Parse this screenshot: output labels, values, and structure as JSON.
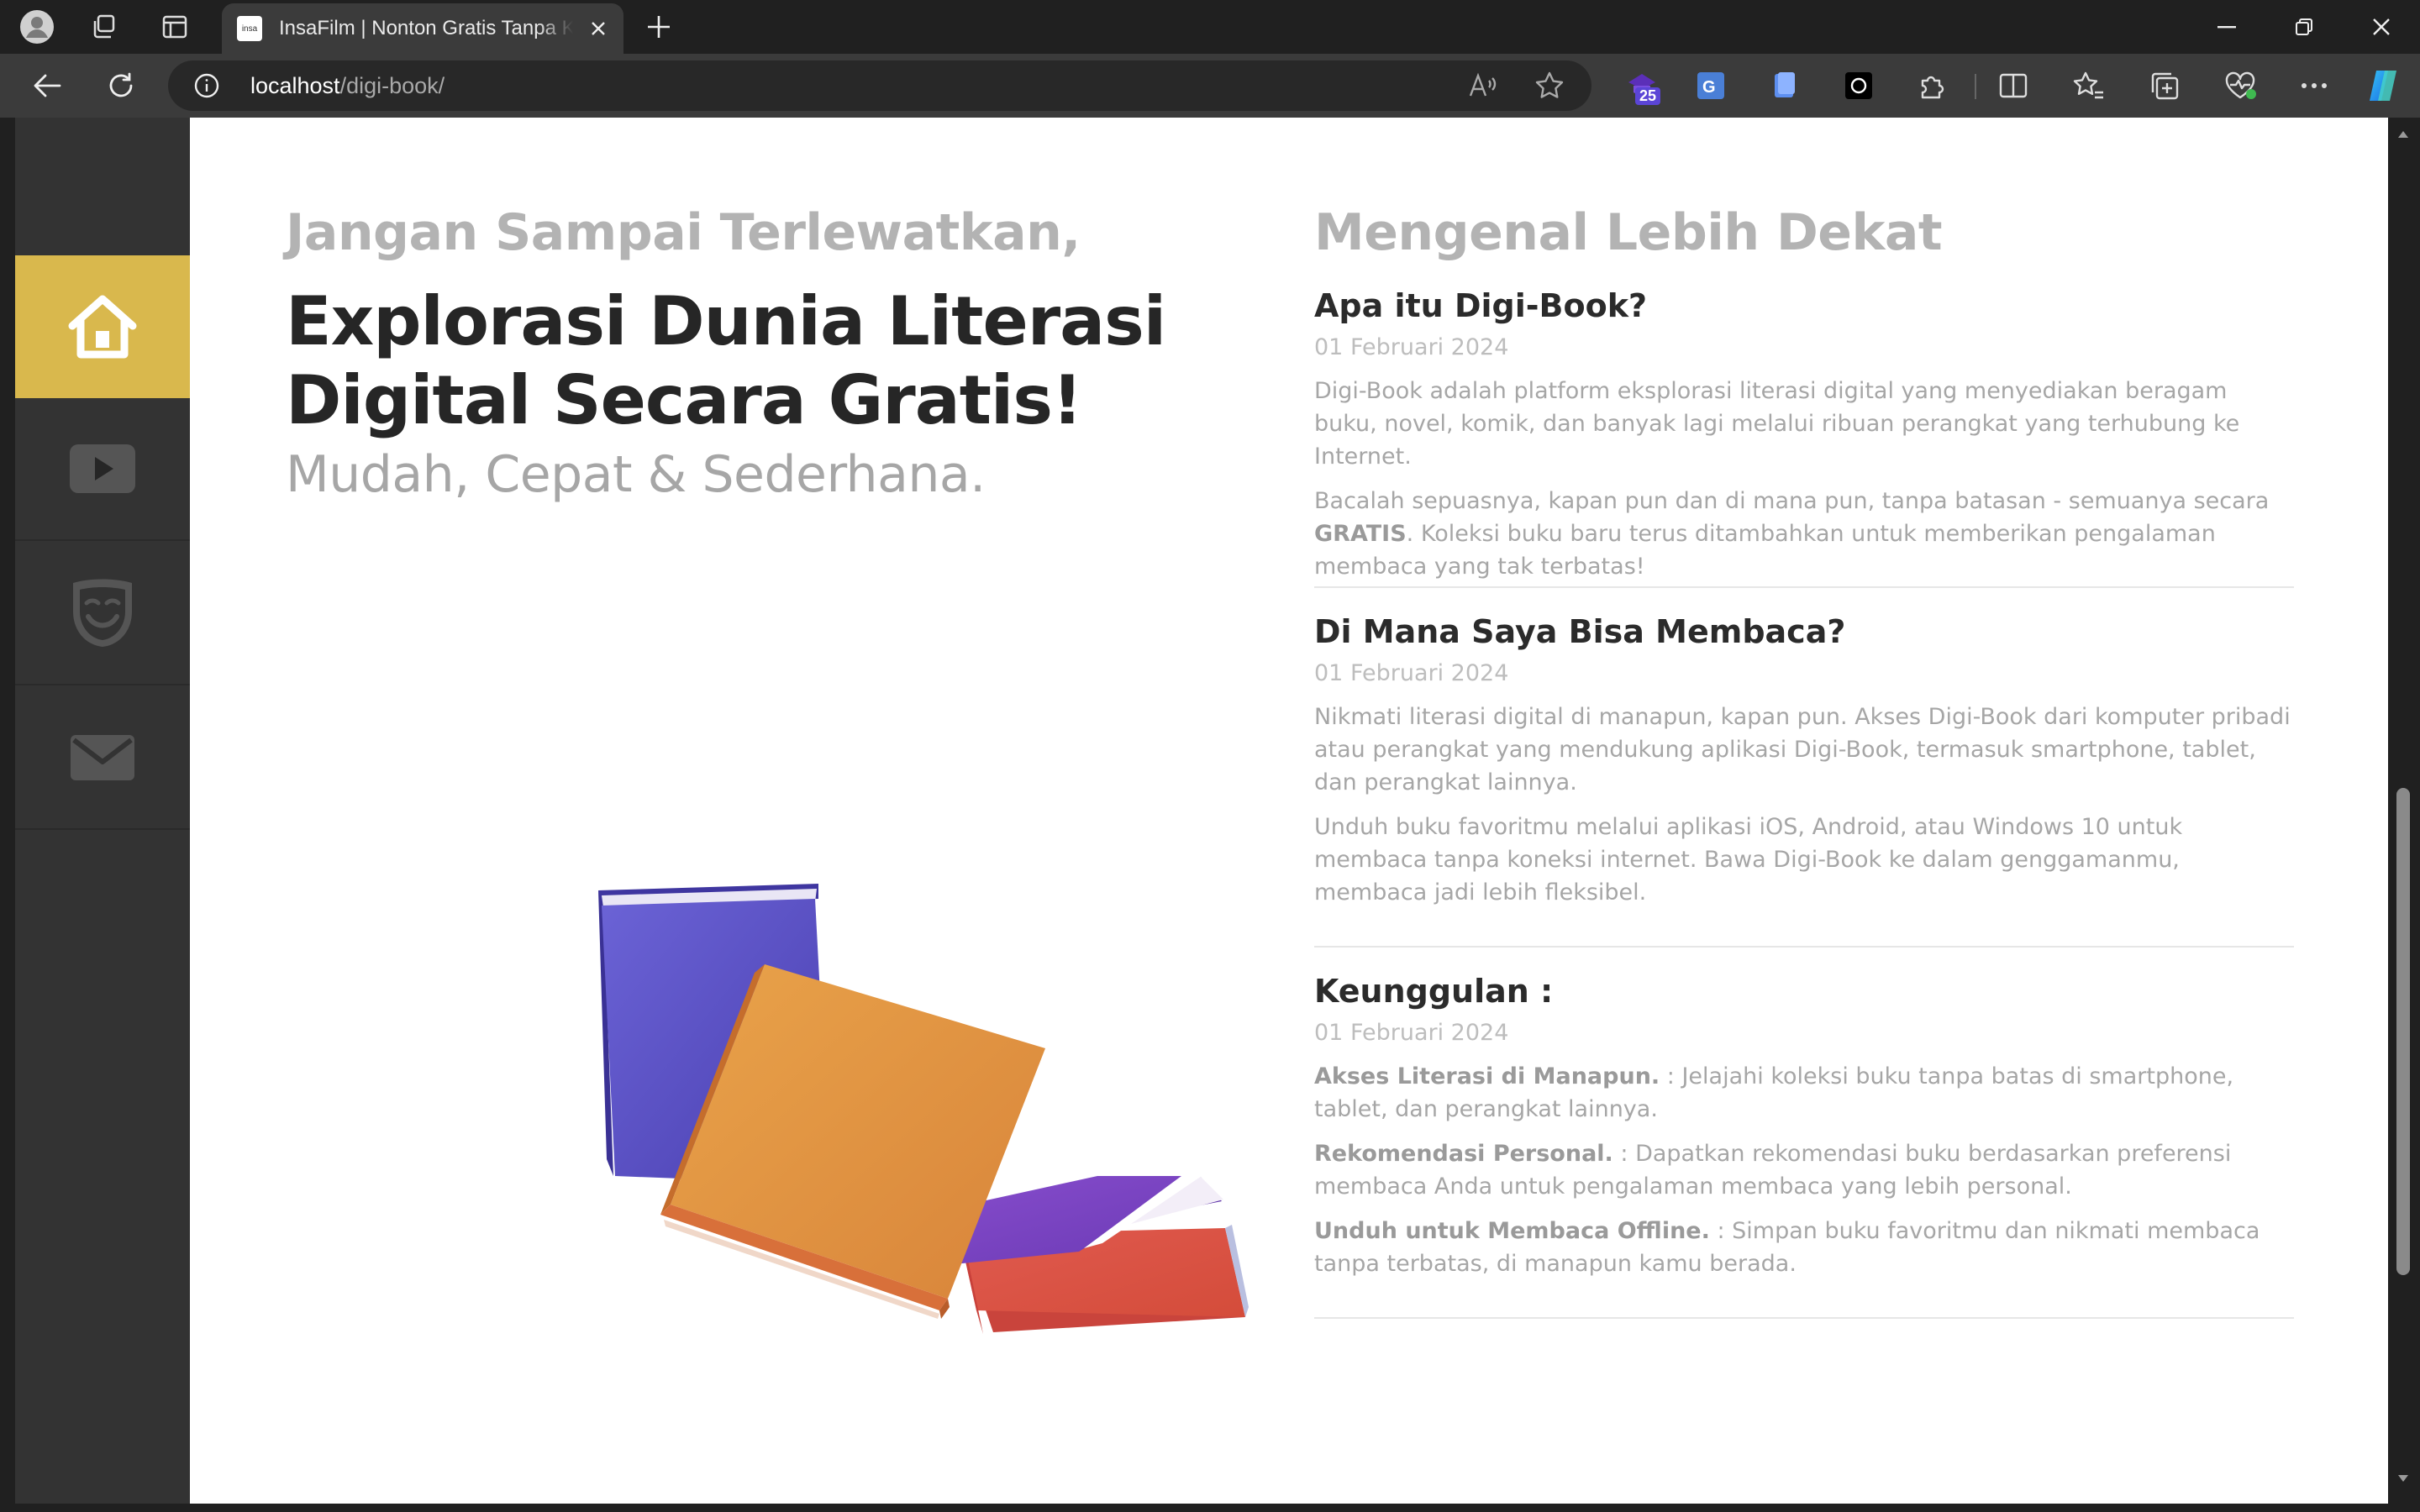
{
  "browser": {
    "tab_title": "InsaFilm | Nonton Gratis Tanpa K",
    "favicon_text": "insa",
    "url_host": "localhost",
    "url_path": "/digi-book/",
    "ext_badge": "25"
  },
  "sidebar": {
    "items": [
      {
        "name": "home",
        "icon": "home-icon",
        "active": true
      },
      {
        "name": "video",
        "icon": "play-icon",
        "active": false
      },
      {
        "name": "masks",
        "icon": "mask-icon",
        "active": false
      },
      {
        "name": "mail",
        "icon": "mail-icon",
        "active": false
      }
    ],
    "active_color": "#d9b84d"
  },
  "hero": {
    "kicker": "Jangan Sampai Terlewatkan,",
    "headline_line1": "Explorasi Dunia Literasi",
    "headline_line2": "Digital Secara Gratis!",
    "subhead": "Mudah, Cepat & Sederhana."
  },
  "about": {
    "title": "Mengenal Lebih Dekat",
    "articles": [
      {
        "title": "Apa itu Digi-Book?",
        "date": "01 Februari 2024",
        "p1": "Digi-Book adalah platform eksplorasi literasi digital yang menyediakan beragam buku, novel, komik, dan banyak lagi melalui ribuan perangkat yang terhubung ke Internet.",
        "p2_before": "Bacalah sepuasnya, kapan pun dan di mana pun, tanpa batasan - semuanya secara ",
        "p2_bold": "GRATIS",
        "p2_after": ". Koleksi buku baru terus ditambahkan untuk memberikan pengalaman membaca yang tak terbatas!"
      },
      {
        "title": "Di Mana Saya Bisa Membaca?",
        "date": "01 Februari 2024",
        "p1": "Nikmati literasi digital di manapun, kapan pun. Akses Digi-Book dari komputer pribadi atau perangkat yang mendukung aplikasi Digi-Book, termasuk smartphone, tablet, dan perangkat lainnya.",
        "p2": "Unduh buku favoritmu melalui aplikasi iOS, Android, atau Windows 10 untuk membaca tanpa koneksi internet. Bawa Digi-Book ke dalam genggamanmu, membaca jadi lebih fleksibel."
      },
      {
        "title": "Keunggulan :",
        "date": "01 Februari 2024",
        "f1_bold": "Akses Literasi di Manapun.",
        "f1_text": " : Jelajahi koleksi buku tanpa batas di smartphone, tablet, dan perangkat lainnya.",
        "f2_bold": "Rekomendasi Personal.",
        "f2_text": " : Dapatkan rekomendasi buku berdasarkan preferensi membaca Anda untuk pengalaman membaca yang lebih personal.",
        "f3_bold": "Unduh untuk Membaca Offline.",
        "f3_text": " : Simpan buku favoritmu dan nikmati membaca tanpa terbatas, di manapun kamu berada."
      }
    ]
  }
}
